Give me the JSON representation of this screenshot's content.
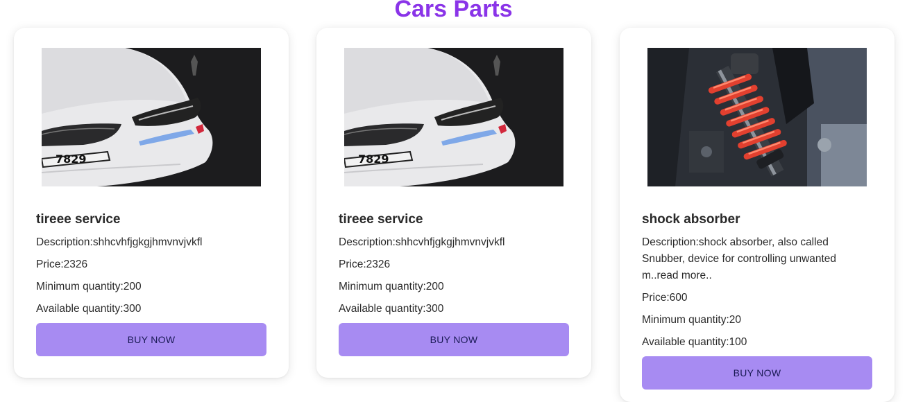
{
  "page": {
    "title": "Cars Parts"
  },
  "colors": {
    "title": "#8a34e8",
    "button_bg": "#a78bf2",
    "button_text": "#1a1a55"
  },
  "products": [
    {
      "image_icon": "car-headlight-image",
      "name": "tireee service",
      "description_label": "Description:",
      "description": "shhcvhfjgkgjhmvnvjvkfl",
      "price_label": "Price:",
      "price": "2326",
      "min_qty_label": "Minimum quantity:",
      "min_qty": "200",
      "avail_qty_label": "Available quantity:",
      "avail_qty": "300",
      "button_label": "BUY NOW"
    },
    {
      "image_icon": "car-headlight-image",
      "name": "tireee service",
      "description_label": "Description:",
      "description": "shhcvhfjgkgjhmvnvjvkfl",
      "price_label": "Price:",
      "price": "2326",
      "min_qty_label": "Minimum quantity:",
      "min_qty": "200",
      "avail_qty_label": "Available quantity:",
      "avail_qty": "300",
      "button_label": "BUY NOW"
    },
    {
      "image_icon": "shock-absorber-image",
      "name": "shock absorber",
      "description_label": "Description:",
      "description": "shock absorber, also called Snubber, device for controlling unwanted m..read more..",
      "price_label": "Price:",
      "price": "600",
      "min_qty_label": "Minimum quantity:",
      "min_qty": "20",
      "avail_qty_label": "Available quantity:",
      "avail_qty": "100",
      "button_label": "BUY NOW"
    }
  ]
}
